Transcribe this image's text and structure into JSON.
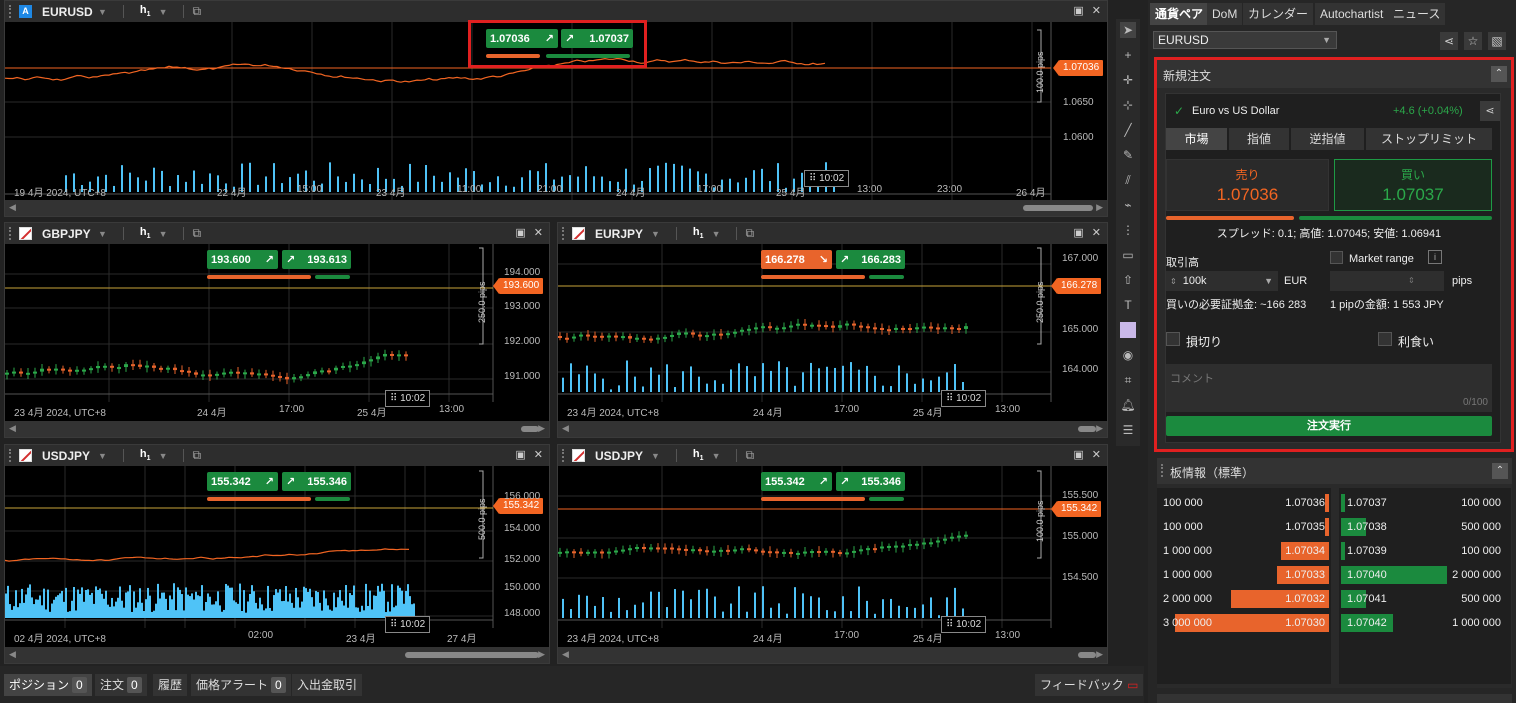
{
  "colors": {
    "up": "#1b8a3e",
    "down": "#e8642c",
    "accent": "#f26522",
    "volume": "#4fc3f7"
  },
  "main_chart": {
    "symbol": "EURUSD",
    "icon_letter": "A",
    "timeframe": "h",
    "timeframe_sub": "1",
    "sell_price": "1.07036",
    "buy_price": "1.07037",
    "current_price": "1.07036",
    "pips": "100.0 pips",
    "y_labels": [
      "1.0650",
      "1.0600"
    ],
    "x_labels": [
      "19 4月 2024, UTC+8",
      "22 4月",
      "15:00",
      "23 4月",
      "11:00",
      "21:00",
      "24 4月",
      "17:00",
      "25 4月",
      "13:00",
      "23:00",
      "26 4月"
    ],
    "time_box": "10:02"
  },
  "gbpjpy": {
    "symbol": "GBPJPY",
    "timeframe": "h",
    "timeframe_sub": "1",
    "sell_price": "193.600",
    "buy_price": "193.613",
    "current_price": "193.600",
    "pips": "250.0 pips",
    "y_labels": [
      "194.000",
      "193.000",
      "192.000",
      "191.000"
    ],
    "x_labels": [
      "23 4月 2024, UTC+8",
      "24 4月",
      "17:00",
      "25 4月",
      "13:00"
    ],
    "time_box": "10:02"
  },
  "eurjpy": {
    "symbol": "EURJPY",
    "timeframe": "h",
    "timeframe_sub": "1",
    "sell_price": "166.278",
    "buy_price": "166.283",
    "current_price": "166.278",
    "pips": "250.0 pips",
    "y_labels": [
      "167.000",
      "165.000",
      "164.000"
    ],
    "x_labels": [
      "23 4月 2024, UTC+8",
      "24 4月",
      "17:00",
      "25 4月",
      "13:00"
    ],
    "time_box": "10:02"
  },
  "usdjpy1": {
    "symbol": "USDJPY",
    "timeframe": "h",
    "timeframe_sub": "1",
    "sell_price": "155.342",
    "buy_price": "155.346",
    "current_price": "155.342",
    "pips": "500.0 pips",
    "y_labels": [
      "156.000",
      "154.000",
      "152.000",
      "150.000",
      "148.000"
    ],
    "x_labels": [
      "02 4月 2024, UTC+8",
      "02:00",
      "23 4月",
      "27 4月"
    ],
    "time_box": "10:02"
  },
  "usdjpy2": {
    "symbol": "USDJPY",
    "timeframe": "h",
    "timeframe_sub": "1",
    "sell_price": "155.342",
    "buy_price": "155.346",
    "current_price": "155.342",
    "pips": "100.0 pips",
    "y_labels": [
      "155.500",
      "155.000",
      "154.500"
    ],
    "x_labels": [
      "23 4月 2024, UTC+8",
      "24 4月",
      "17:00",
      "25 4月",
      "13:00"
    ],
    "time_box": "10:02"
  },
  "right_tabs": [
    "通貨ペア",
    "DoM",
    "カレンダー",
    "Autochartist",
    "ニュース"
  ],
  "pair_select": "EURUSD",
  "new_order": {
    "title": "新規注文",
    "instrument": "Euro vs US Dollar",
    "change": "+4.6 (+0.04%)",
    "order_tabs": [
      "市場",
      "指値",
      "逆指値",
      "ストップリミット"
    ],
    "sell_label": "売り",
    "sell_price": "1.07036",
    "buy_label": "買い",
    "buy_price": "1.07037",
    "spread_info": "スプレッド: 0.1; 高値: 1.07045; 安値: 1.06941",
    "volume_label": "取引高",
    "volume_value": "100k",
    "currency": "EUR",
    "market_range": "Market range",
    "pips_label": "pips",
    "margin": "買いの必要証拠金: ~166 283",
    "pip_value": "1 pipの金額: 1 553 JPY",
    "stop_loss": "損切り",
    "take_profit": "利食い",
    "comment_placeholder": "コメント",
    "comment_count": "0/100",
    "execute": "注文実行"
  },
  "order_book": {
    "title": "板情報（標準）",
    "bids": [
      {
        "vol": "100 000",
        "price": "1.07036"
      },
      {
        "vol": "100 000",
        "price": "1.07035"
      },
      {
        "vol": "1 000 000",
        "price": "1.07034"
      },
      {
        "vol": "1 000 000",
        "price": "1.07033"
      },
      {
        "vol": "2 000 000",
        "price": "1.07032"
      },
      {
        "vol": "3 000 000",
        "price": "1.07030"
      }
    ],
    "asks": [
      {
        "price": "1.07037",
        "vol": "100 000"
      },
      {
        "price": "1.07038",
        "vol": "500 000"
      },
      {
        "price": "1.07039",
        "vol": "100 000"
      },
      {
        "price": "1.07040",
        "vol": "2 000 000"
      },
      {
        "price": "1.07041",
        "vol": "500 000"
      },
      {
        "price": "1.07042",
        "vol": "1 000 000"
      }
    ]
  },
  "bottom_tabs": [
    {
      "label": "ポジション",
      "count": "0"
    },
    {
      "label": "注文",
      "count": "0"
    },
    {
      "label": "履歴"
    },
    {
      "label": "価格アラート",
      "count": "0"
    },
    {
      "label": "入出金取引"
    }
  ],
  "feedback": "フィードバック"
}
